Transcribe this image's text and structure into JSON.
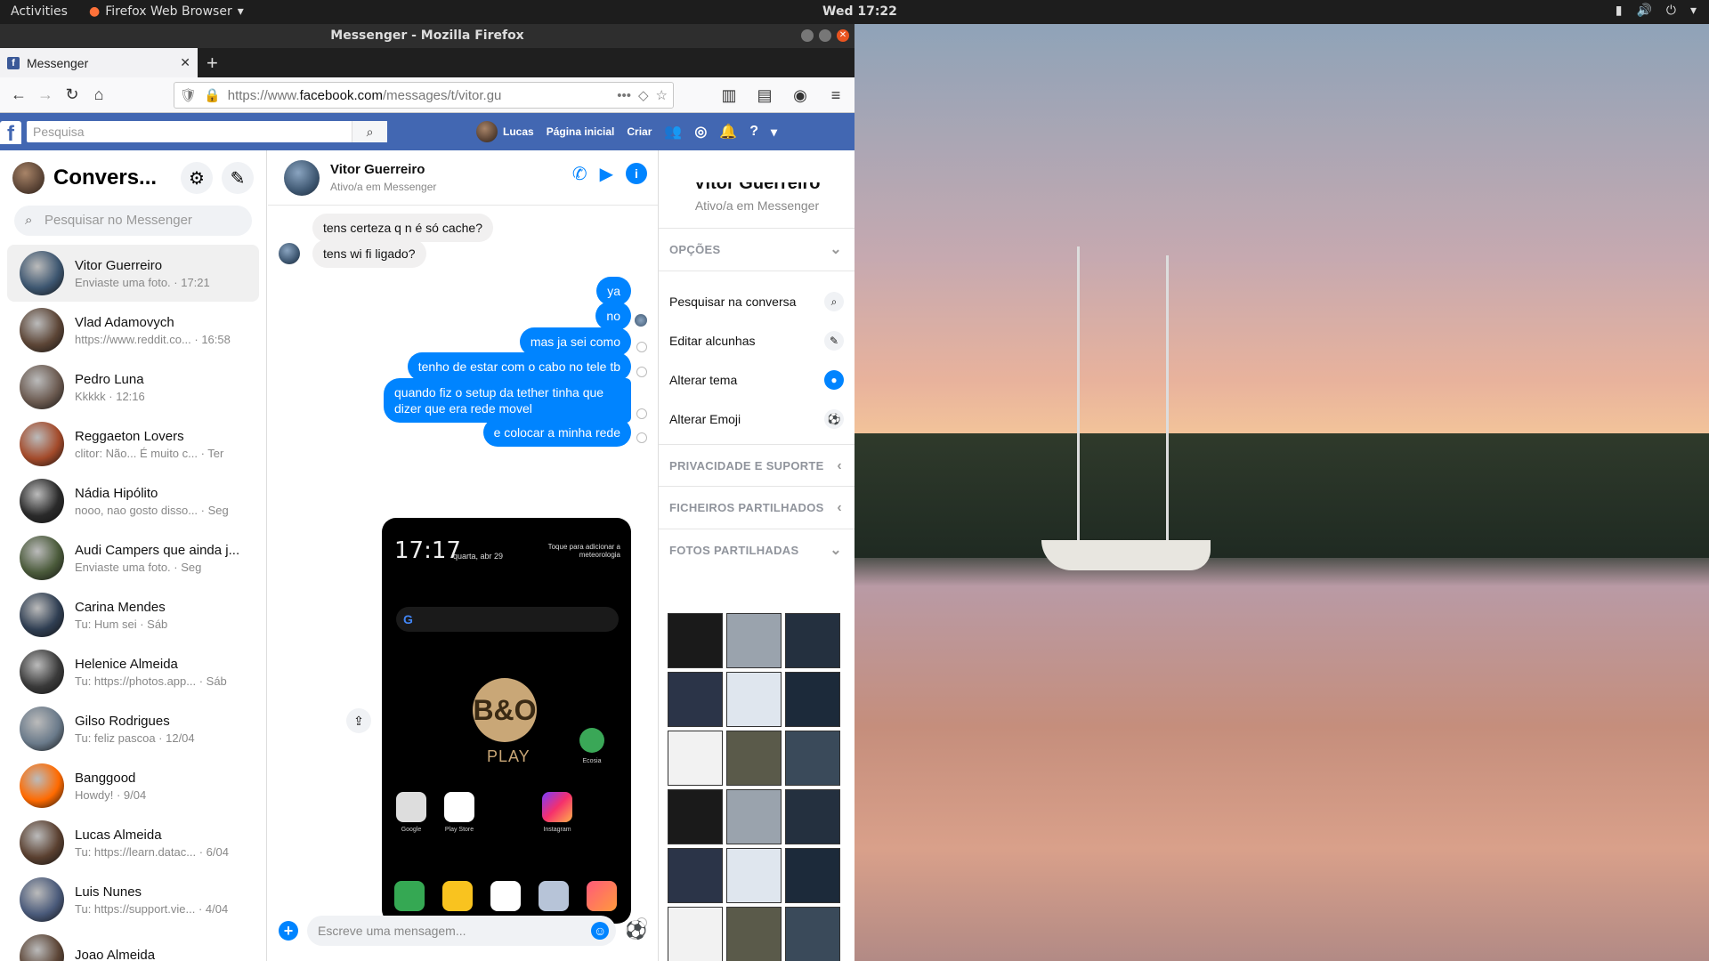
{
  "system": {
    "activities": "Activities",
    "app_menu": "Firefox Web Browser",
    "clock": "Wed 17:22"
  },
  "window": {
    "title": "Messenger - Mozilla Firefox"
  },
  "tab": {
    "label": "Messenger"
  },
  "url": {
    "prefix": "https://www.",
    "domain": "facebook.com",
    "path": "/messages/t/vitor.gu"
  },
  "fb": {
    "search_placeholder": "Pesquisa",
    "user": "Lucas",
    "home": "Página inicial",
    "create": "Criar"
  },
  "sidebar": {
    "title": "Convers...",
    "search_placeholder": "Pesquisar no Messenger",
    "conversations": [
      {
        "name": "Vitor Guerreiro",
        "snippet": "Enviaste uma foto. · 17:21"
      },
      {
        "name": "Vlad Adamovych",
        "snippet": "https://www.reddit.co... · 16:58"
      },
      {
        "name": "Pedro Luna",
        "snippet": "Kkkkk · 12:16"
      },
      {
        "name": "Reggaeton Lovers",
        "snippet": "clitor: Não... É muito c... · Ter"
      },
      {
        "name": "Nádia Hipólito",
        "snippet": "nooo, nao gosto disso... · Seg"
      },
      {
        "name": "Audi Campers que ainda j...",
        "snippet": "Enviaste uma foto. · Seg"
      },
      {
        "name": "Carina Mendes",
        "snippet": "Tu: Hum sei · Sáb"
      },
      {
        "name": "Helenice Almeida",
        "snippet": "Tu: https://photos.app... · Sáb"
      },
      {
        "name": "Gilso Rodrigues",
        "snippet": "Tu: feliz pascoa · 12/04"
      },
      {
        "name": "Banggood",
        "snippet": "Howdy! · 9/04"
      },
      {
        "name": "Lucas Almeida",
        "snippet": "Tu: https://learn.datac... · 6/04"
      },
      {
        "name": "Luis Nunes",
        "snippet": "Tu: https://support.vie... · 4/04"
      },
      {
        "name": "Joao Almeida",
        "snippet": ""
      }
    ]
  },
  "chat": {
    "name": "Vitor Guerreiro",
    "status": "Ativo/a em Messenger",
    "incoming": [
      "tens certeza q n é só cache?",
      "tens wi fi ligado?"
    ],
    "outgoing": [
      "ya",
      "no",
      "mas ja sei como",
      "tenho de estar com o cabo no tele tb",
      "quando fiz o setup da tether tinha que dizer que era rede movel",
      "e colocar a minha rede"
    ],
    "phone": {
      "time": "17:17",
      "date": "quarta, abr 29",
      "weather": "Toque para adicionar a meteorologia",
      "logo": "B&O",
      "play": "PLAY",
      "apps": [
        "Google",
        "Play Store",
        "Instagram",
        "Ecosia"
      ]
    },
    "compose_placeholder": "Escreve uma mensagem..."
  },
  "info": {
    "name": "Vitor Guerreiro",
    "status": "Ativo/a em Messenger",
    "options_header": "OPÇÕES",
    "options": [
      "Pesquisar na conversa",
      "Editar alcunhas",
      "Alterar tema",
      "Alterar Emoji"
    ],
    "privacy": "PRIVACIDADE E SUPORTE",
    "files": "FICHEIROS PARTILHADOS",
    "photos": "FOTOS PARTILHADAS"
  },
  "colors": {
    "fb_blue": "#4267b2",
    "messenger_blue": "#0084ff",
    "topbar": "#1d1d1d"
  }
}
